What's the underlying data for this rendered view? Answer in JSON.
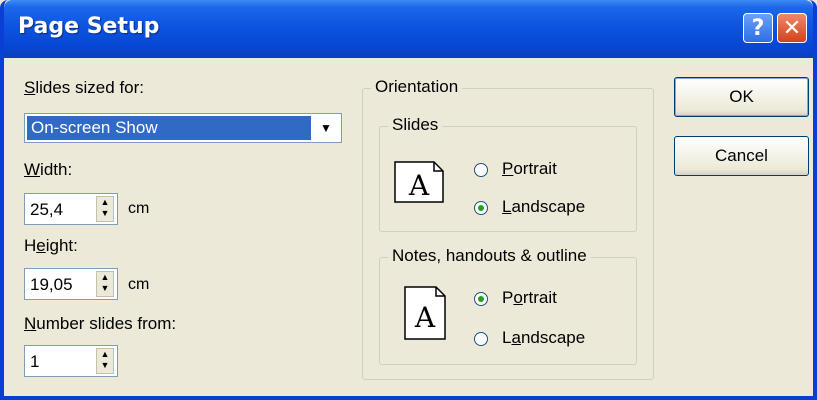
{
  "window": {
    "title": "Page Setup"
  },
  "titlebar": {
    "help_glyph": "?",
    "close_glyph": "✕"
  },
  "left": {
    "slides_sized_for": {
      "label_first": "S",
      "label_rest": "lides sized for:",
      "selected": "On-screen Show"
    },
    "width": {
      "label_first": "W",
      "label_rest": "idth:",
      "value": "25,4",
      "unit": "cm"
    },
    "height": {
      "label_pre": "H",
      "label_u": "e",
      "label_rest": "ight:",
      "value": "19,05",
      "unit": "cm"
    },
    "number_from": {
      "label_first": "N",
      "label_rest": "umber slides from:",
      "value": "1"
    }
  },
  "orientation": {
    "title": "Orientation",
    "slides": {
      "title": "Slides",
      "portrait": {
        "label_first": "P",
        "label_rest": "ortrait",
        "selected": false
      },
      "landscape": {
        "label_first": "L",
        "label_rest": "andscape",
        "selected": true
      }
    },
    "notes": {
      "title": "Notes, handouts & outline",
      "portrait": {
        "label_pre": "P",
        "label_u": "o",
        "label_rest": "rtrait",
        "selected": true
      },
      "landscape": {
        "label_pre": "L",
        "label_u": "a",
        "label_rest": "ndscape",
        "selected": false
      }
    }
  },
  "buttons": {
    "ok": "OK",
    "cancel": "Cancel"
  },
  "icons": {
    "landscape_page": "A",
    "portrait_page": "A"
  },
  "colors": {
    "titlebar": "#0b55e0",
    "selection": "#316ac5",
    "dialog_bg": "#ece9d8"
  }
}
